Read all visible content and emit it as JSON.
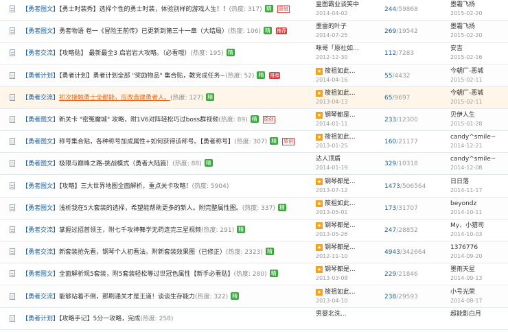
{
  "heat_label": "热度",
  "rows": [
    {
      "category": "【勇者图文】",
      "title": "【勇士时装秀】选择个性的勇士时装，体验别样的游戏人生！！",
      "heat": "317",
      "tags": [
        "fine",
        "orig"
      ],
      "author": "皇图霸业谈笑中",
      "starred": false,
      "post_date": "2014-04-02",
      "replies": "244",
      "views": "59868",
      "last_user": "墨霜飞扬",
      "last_date": "2015-02-20",
      "style": "normal"
    },
    {
      "category": "【勇者图文】",
      "title": "勇者物语 卷一《冒险王前传》已更新到第三十一章（大结局）",
      "heat": "106",
      "tags": [
        "fine",
        "rec"
      ],
      "author": "墨雷的叶子",
      "starred": false,
      "post_date": "2014-07-25",
      "replies": "269",
      "views": "19542",
      "last_user": "墨霜飞扬",
      "last_date": "2015-02-20",
      "style": "normal"
    },
    {
      "category": "【勇者交流】",
      "title": "【攻略贴】 最新最全3 启岩岩大攻略。（必看哦）",
      "heat": "195",
      "tags": [
        "fine"
      ],
      "author": "咪哥「原社如...",
      "starred": false,
      "post_date": "2012-12-30",
      "replies": "112",
      "views": "7283",
      "last_user": "安吉",
      "last_date": "2015-02-16",
      "style": "normal"
    },
    {
      "category": "【勇者计划】",
      "title": "【勇者计划】勇者计划全部 \"奖励物品\" 集合贴，教完成任务~",
      "heat": "52",
      "tags": [
        "fine",
        "rec"
      ],
      "author": "筱祖如此...",
      "starred": true,
      "post_date": "2014-04-16",
      "replies": "55",
      "views": "4432",
      "last_user": "今朝厂-恶城",
      "last_date": "2015-02-11",
      "style": "normal"
    },
    {
      "category": "【勇者交流】",
      "title": "初次接触勇士全都能，应改造建勇者人。",
      "heat": "127",
      "tags": [
        "fine"
      ],
      "author": "筱祖如此...",
      "starred": true,
      "post_date": "2013-04-13",
      "replies": "65",
      "views": "9697",
      "last_user": "今朝厂-恶城",
      "last_date": "2015-02-11",
      "style": "highlight"
    },
    {
      "category": "【勇者图文】",
      "title": "新关卡 \"密冤魔城\" 攻略，附1V6对阵轻松巧过boss群视频",
      "heat": "89",
      "tags": [
        "fine",
        "orig"
      ],
      "author": "钢琴都是...",
      "starred": true,
      "post_date": "2014-01-11",
      "replies": "233",
      "views": "12300",
      "last_user": "贝伊人生",
      "last_date": "2015-01-28",
      "style": "normal"
    },
    {
      "category": "【勇者图文】",
      "title": "称号集合贴，各种称号加成属性+如何获得该称号。【勇者称号】",
      "heat": "307",
      "tags": [
        "fine",
        "orig"
      ],
      "author": "筱祖如此...",
      "starred": true,
      "post_date": "2013-01-25",
      "replies": "160",
      "views": "21177",
      "last_user": "candy^smile~",
      "last_date": "2014-12-21",
      "style": "normal"
    },
    {
      "category": "【勇者图文】",
      "title": "极限与巅峰之路-挑战模式（勇者大陆篇）",
      "heat": "88",
      "tags": [
        "fine"
      ],
      "author": "达人顶盾",
      "starred": false,
      "post_date": "2014-01-19",
      "replies": "329",
      "views": "10318",
      "last_user": "candy^smile~",
      "last_date": "2014-12-08",
      "style": "normal"
    },
    {
      "category": "【勇者图文】",
      "title": "【攻略】三大世界地图全面解析，重点关卡攻略！",
      "heat": "5904",
      "tags": [],
      "author": "钢琴都是...",
      "starred": true,
      "post_date": "2013-07-12",
      "replies": "1473",
      "views": "506564",
      "last_user": "日日落",
      "last_date": "2014-11-17",
      "style": "normal"
    },
    {
      "category": "【勇者图文】",
      "title": "浅析我在5大套装的选择，希望能帮助更多的新人。附完整属性图。",
      "heat": "337",
      "tags": [
        "fine"
      ],
      "author": "筱祖如此...",
      "starred": true,
      "post_date": "2013-05-01",
      "replies": "173",
      "views": "31707",
      "last_user": "beyondz",
      "last_date": "2014-10-11",
      "style": "normal"
    },
    {
      "category": "【勇者交流】",
      "title": "掌握过招首领王，附七千攻神舞学无药连完三星视频",
      "heat": "291",
      "tags": [
        "fine"
      ],
      "author": "钢琴都是...",
      "starred": true,
      "post_date": "2013-05-26",
      "replies": "247",
      "views": "28852",
      "last_user": "My、小猎司",
      "last_date": "2014-10-03",
      "style": "normal"
    },
    {
      "category": "【勇者交流】",
      "title": "新套装抢先看，钢琴个人初看法。附新套装效果图（已修正）",
      "heat": "2323",
      "tags": [
        "fine"
      ],
      "author": "钢琴都是...",
      "starred": true,
      "post_date": "2012-11-10",
      "replies": "4943",
      "views": "342664",
      "last_user": "1376776",
      "last_date": "2014-09-20",
      "style": "normal"
    },
    {
      "category": "【勇者图文】",
      "title": "全面解析现5套装，附5套装轻松等过世冠色属性【新手必看贴】",
      "heat": "280",
      "tags": [
        "fine"
      ],
      "author": "钢琴都是...",
      "starred": true,
      "post_date": "2013-03-08",
      "replies": "229",
      "views": "21846",
      "last_user": "墨雨天星",
      "last_date": "2014-09-13",
      "style": "normal"
    },
    {
      "category": "【勇者交流】",
      "title": "能够站着不倒，那刷通关才是王道！谈谈生存能力",
      "heat": "322",
      "tags": [
        "fine"
      ],
      "author": "筱祖如此...",
      "starred": true,
      "post_date": "2013-04-10",
      "replies": "238",
      "views": "29593",
      "last_user": "小号光荣",
      "last_date": "2014-08-17",
      "style": "normal"
    },
    {
      "category": "【勇者计划】",
      "title": "【攻略手记】5分一攻略，完成",
      "heat": "258",
      "tags": [],
      "author": "男婴北洗...",
      "starred": false,
      "post_date": "",
      "replies": "",
      "views": "",
      "last_user": "超能影白月",
      "last_date": "",
      "style": "normal"
    }
  ],
  "tag_labels": {
    "fine": "精",
    "rec": "推荐",
    "orig": "原创"
  },
  "star_glyph": "★",
  "colors": {
    "link": "#1d5f9e",
    "orange": "#e8661a",
    "green": "#39a83c",
    "red": "#d93a3a",
    "star": "#f0a321"
  }
}
